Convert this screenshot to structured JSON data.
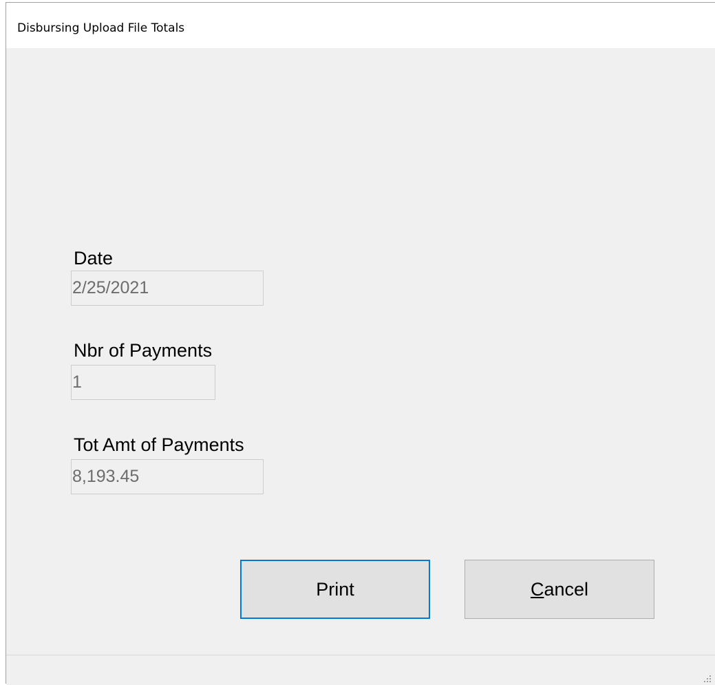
{
  "window": {
    "title": "Disbursing Upload File Totals"
  },
  "fields": {
    "date": {
      "label": "Date",
      "value": "2/25/2021"
    },
    "nbr_payments": {
      "label": "Nbr of Payments",
      "value": "1"
    },
    "tot_amt": {
      "label": "Tot Amt of Payments",
      "value": "8,193.45"
    }
  },
  "buttons": {
    "print": {
      "label": "Print"
    },
    "cancel": {
      "mnemonic": "C",
      "rest": "ancel"
    }
  },
  "colors": {
    "window_bg": "#f0f0f0",
    "default_button_border": "#0078d7",
    "readonly_text": "#6d6d6d"
  },
  "icons": {
    "resize_grip": "size-grip-icon"
  }
}
